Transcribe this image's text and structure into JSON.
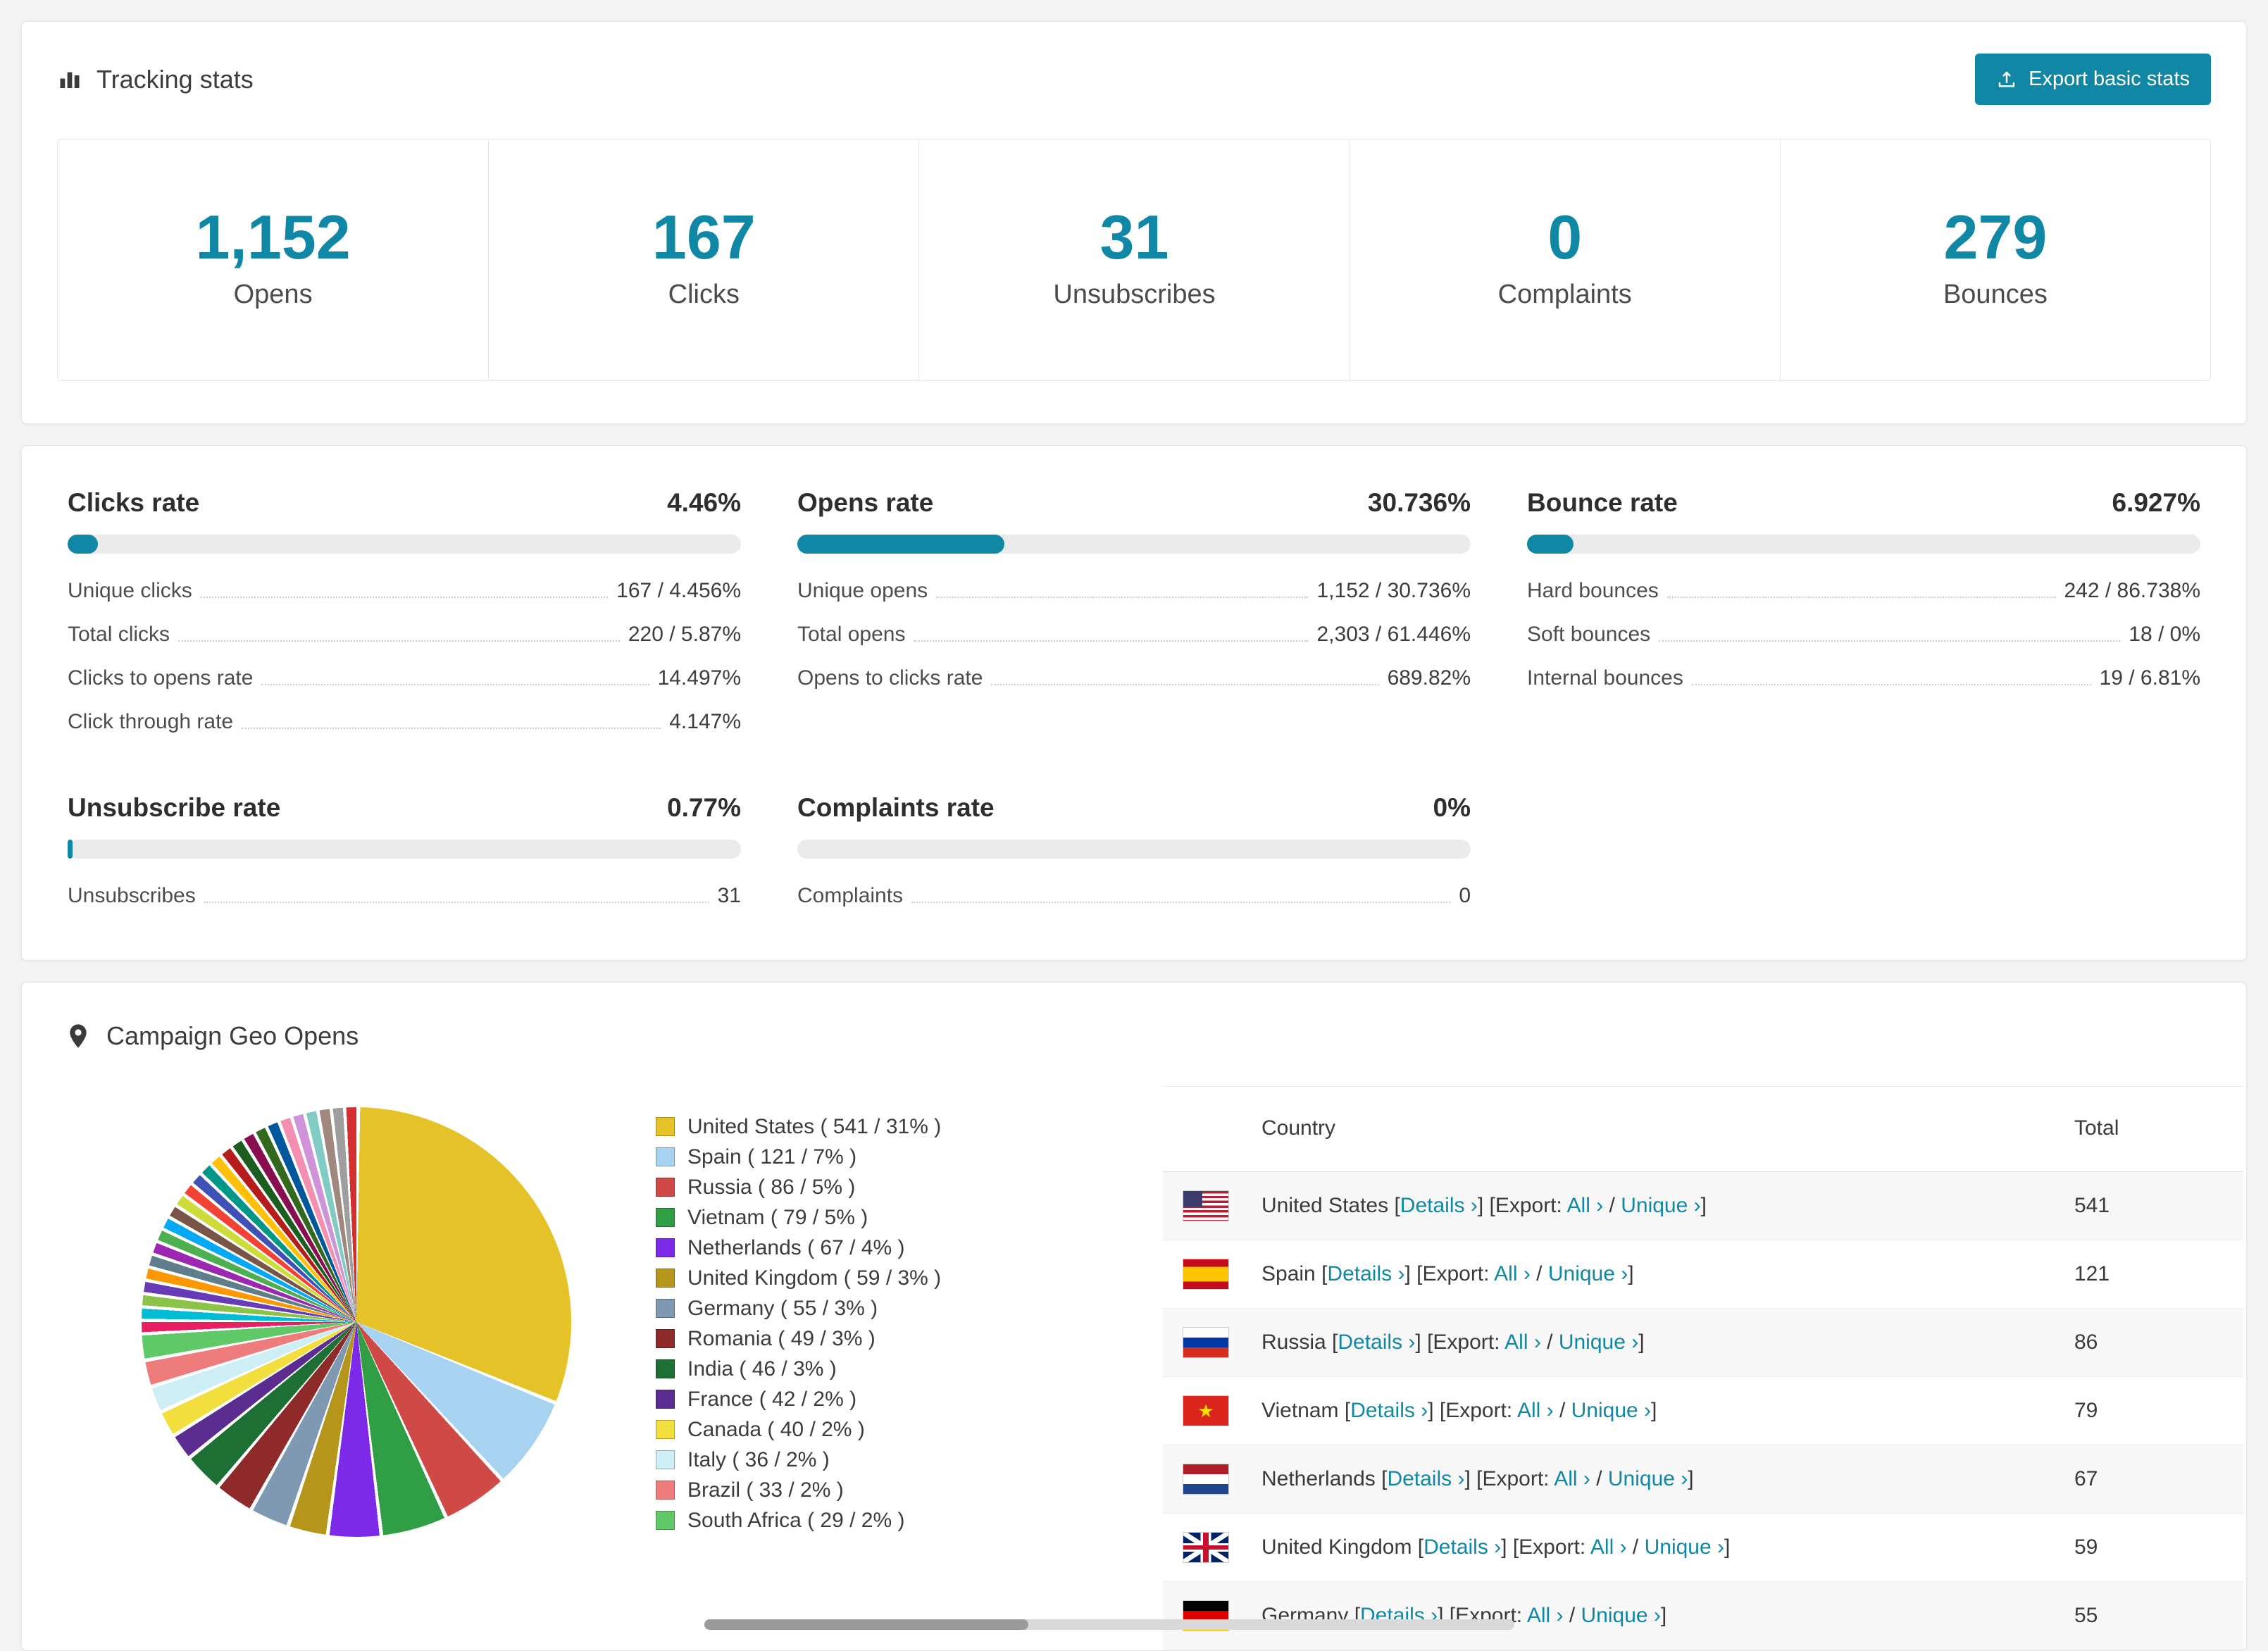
{
  "colors": {
    "accent": "#1088a5"
  },
  "tracking": {
    "title": "Tracking stats",
    "export_button": "Export basic stats",
    "stats": [
      {
        "value": "1,152",
        "label": "Opens"
      },
      {
        "value": "167",
        "label": "Clicks"
      },
      {
        "value": "31",
        "label": "Unsubscribes"
      },
      {
        "value": "0",
        "label": "Complaints"
      },
      {
        "value": "279",
        "label": "Bounces"
      }
    ]
  },
  "rates": {
    "sections": [
      {
        "title": "Clicks rate",
        "value": "4.46%",
        "percent": 4.46,
        "rows": [
          {
            "label": "Unique clicks",
            "value": "167 / 4.456%"
          },
          {
            "label": "Total clicks",
            "value": "220 / 5.87%"
          },
          {
            "label": "Clicks to opens rate",
            "value": "14.497%"
          },
          {
            "label": "Click through rate",
            "value": "4.147%"
          }
        ]
      },
      {
        "title": "Opens rate",
        "value": "30.736%",
        "percent": 30.736,
        "rows": [
          {
            "label": "Unique opens",
            "value": "1,152 / 30.736%"
          },
          {
            "label": "Total opens",
            "value": "2,303 / 61.446%"
          },
          {
            "label": "Opens to clicks rate",
            "value": "689.82%"
          }
        ]
      },
      {
        "title": "Bounce rate",
        "value": "6.927%",
        "percent": 6.927,
        "rows": [
          {
            "label": "Hard bounces",
            "value": "242 / 86.738%"
          },
          {
            "label": "Soft bounces",
            "value": "18 / 0%"
          },
          {
            "label": "Internal bounces",
            "value": "19 / 6.81%"
          }
        ]
      },
      {
        "title": "Unsubscribe rate",
        "value": "0.77%",
        "percent": 0.77,
        "rows": [
          {
            "label": "Unsubscribes",
            "value": "31"
          }
        ]
      },
      {
        "title": "Complaints rate",
        "value": "0%",
        "percent": 0,
        "rows": [
          {
            "label": "Complaints",
            "value": "0"
          }
        ]
      }
    ]
  },
  "geo": {
    "title": "Campaign Geo Opens",
    "table": {
      "country_header": "Country",
      "total_header": "Total",
      "links": {
        "details": "Details ›",
        "export_label": "Export:",
        "all": "All ›",
        "unique": "Unique ›"
      },
      "brackets": {
        "open": "[",
        "close": "]",
        "slash": "/"
      },
      "rows": [
        {
          "country": "United States",
          "flag": "us",
          "total": "541"
        },
        {
          "country": "Spain",
          "flag": "es",
          "total": "121"
        },
        {
          "country": "Russia",
          "flag": "ru",
          "total": "86"
        },
        {
          "country": "Vietnam",
          "flag": "vn",
          "total": "79"
        },
        {
          "country": "Netherlands",
          "flag": "nl",
          "total": "67"
        },
        {
          "country": "United Kingdom",
          "flag": "gb",
          "total": "59"
        },
        {
          "country": "Germany",
          "flag": "de",
          "total": "55"
        }
      ]
    }
  },
  "chart_data": {
    "type": "pie",
    "title": "Campaign Geo Opens",
    "legend_position": "right",
    "slices": [
      {
        "label": "United States",
        "value": 541,
        "percent": 31,
        "color": "#e6c229"
      },
      {
        "label": "Spain",
        "value": 121,
        "percent": 7,
        "color": "#a8d3f0"
      },
      {
        "label": "Russia",
        "value": 86,
        "percent": 5,
        "color": "#cf4a47"
      },
      {
        "label": "Vietnam",
        "value": 79,
        "percent": 5,
        "color": "#2f9e44"
      },
      {
        "label": "Netherlands",
        "value": 67,
        "percent": 4,
        "color": "#7d2ae8"
      },
      {
        "label": "United Kingdom",
        "value": 59,
        "percent": 3,
        "color": "#b5951a"
      },
      {
        "label": "Germany",
        "value": 55,
        "percent": 3,
        "color": "#7f99b2"
      },
      {
        "label": "Romania",
        "value": 49,
        "percent": 3,
        "color": "#8e2a2a"
      },
      {
        "label": "India",
        "value": 46,
        "percent": 3,
        "color": "#1e6f34"
      },
      {
        "label": "France",
        "value": 42,
        "percent": 2,
        "color": "#5b2d90"
      },
      {
        "label": "Canada",
        "value": 40,
        "percent": 2,
        "color": "#f2de3c"
      },
      {
        "label": "Italy",
        "value": 36,
        "percent": 2,
        "color": "#cdeef5"
      },
      {
        "label": "Brazil",
        "value": 33,
        "percent": 2,
        "color": "#ee7c7c"
      },
      {
        "label": "South Africa",
        "value": 29,
        "percent": 2,
        "color": "#5fc968"
      }
    ],
    "others_percent": 26,
    "others_colors": [
      "#e91e63",
      "#00bcd4",
      "#8bc34a",
      "#673ab7",
      "#ff9800",
      "#607d8b",
      "#9c27b0",
      "#4caf50",
      "#03a9f4",
      "#795548",
      "#cddc39",
      "#f44336",
      "#3f51b5",
      "#009688",
      "#ffc107",
      "#b71c1c",
      "#1b5e20",
      "#880e4f",
      "#33691e",
      "#01579b",
      "#f48fb1",
      "#ce93d8",
      "#80cbc4",
      "#a1887f",
      "#9e9e9e",
      "#d32f2f"
    ]
  }
}
